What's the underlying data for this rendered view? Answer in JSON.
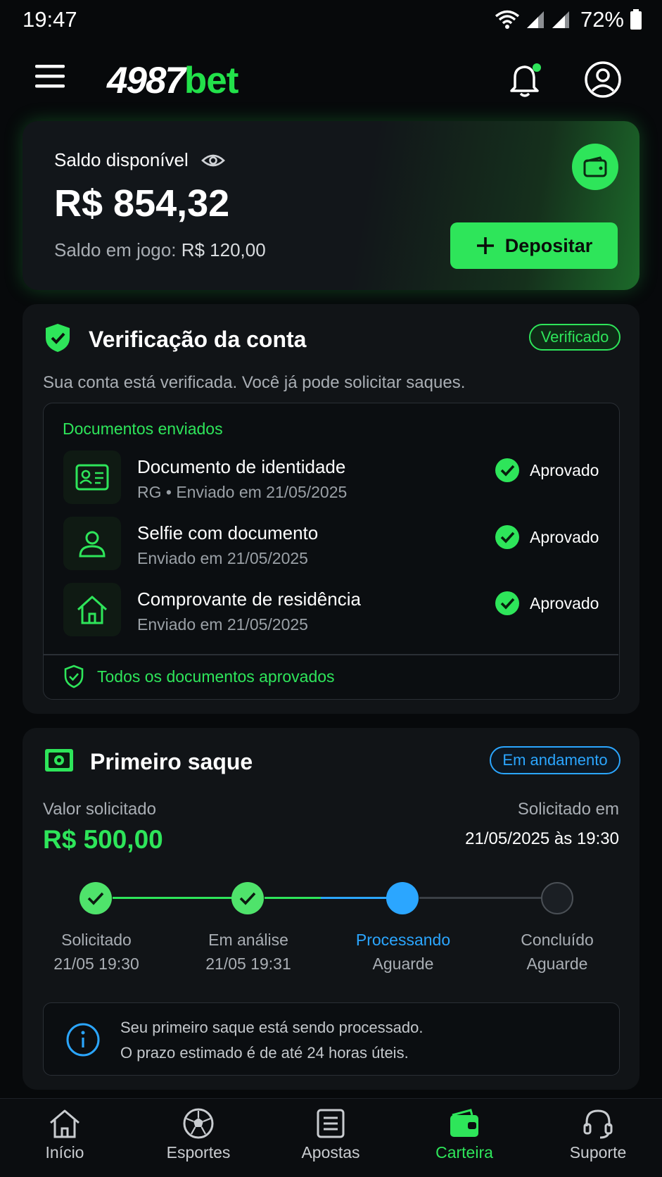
{
  "status_bar": {
    "time": "19:47",
    "battery": "72%"
  },
  "header": {
    "logo_number": "4987",
    "logo_suffix": "bet"
  },
  "balance": {
    "label": "Saldo disponível",
    "amount": "R$ 854,32",
    "in_game_label": "Saldo em jogo:",
    "in_game_value": "R$ 120,00",
    "deposit_label": "Depositar"
  },
  "verification": {
    "title": "Verificação da conta",
    "badge": "Verificado",
    "description": "Sua conta está verificada. Você já pode solicitar saques.",
    "documents_heading": "Documentos enviados",
    "documents": [
      {
        "title": "Documento de identidade",
        "subtitle": "RG • Enviado em 21/05/2025",
        "status": "Aprovado",
        "icon": "id-card-icon"
      },
      {
        "title": "Selfie com documento",
        "subtitle": "Enviado em 21/05/2025",
        "status": "Aprovado",
        "icon": "person-icon"
      },
      {
        "title": "Comprovante de residência",
        "subtitle": "Enviado em 21/05/2025",
        "status": "Aprovado",
        "icon": "house-icon"
      }
    ],
    "footer": "Todos os documentos aprovados"
  },
  "withdrawal": {
    "title": "Primeiro saque",
    "badge": "Em andamento",
    "requested_label": "Valor solicitado",
    "requested_value": "R$ 500,00",
    "date_label": "Solicitado em",
    "date_value": "21/05/2025 às 19:30",
    "steps": [
      {
        "label": "Solicitado",
        "sub": "21/05 19:30",
        "state": "done"
      },
      {
        "label": "Em análise",
        "sub": "21/05 19:31",
        "state": "done"
      },
      {
        "label": "Processando",
        "sub": "Aguarde",
        "state": "current"
      },
      {
        "label": "Concluído",
        "sub": "Aguarde",
        "state": "pending"
      }
    ],
    "info_line1": "Seu primeiro saque está sendo processado.",
    "info_line2": "O prazo estimado é de até 24 horas úteis."
  },
  "nav": [
    {
      "label": "Início",
      "icon": "home-icon",
      "active": false
    },
    {
      "label": "Esportes",
      "icon": "soccer-ball-icon",
      "active": false
    },
    {
      "label": "Apostas",
      "icon": "ticket-icon",
      "active": false
    },
    {
      "label": "Carteira",
      "icon": "wallet-icon",
      "active": true
    },
    {
      "label": "Suporte",
      "icon": "headset-icon",
      "active": false
    }
  ],
  "colors": {
    "accent": "#2ee55a",
    "info": "#2ba6ff",
    "background": "#07090b"
  }
}
